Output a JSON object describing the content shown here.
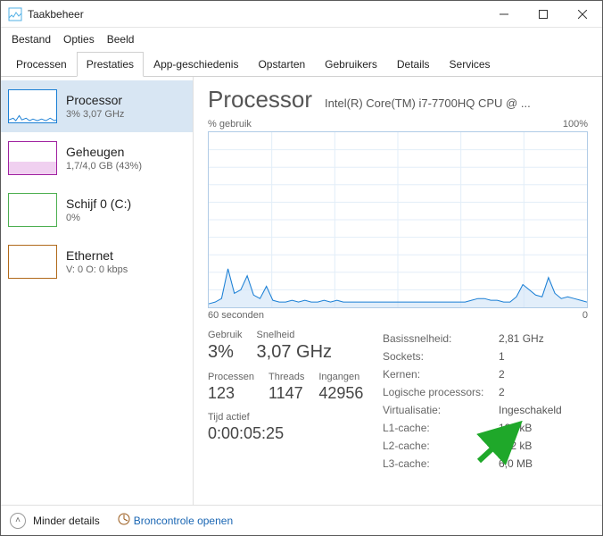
{
  "window": {
    "title": "Taakbeheer"
  },
  "menubar": {
    "items": [
      "Bestand",
      "Opties",
      "Beeld"
    ]
  },
  "tabs": {
    "items": [
      "Processen",
      "Prestaties",
      "App-geschiedenis",
      "Opstarten",
      "Gebruikers",
      "Details",
      "Services"
    ],
    "activeIndex": 1
  },
  "sidebar": {
    "items": [
      {
        "name": "Processor",
        "sub": "3% 3,07 GHz",
        "selected": true
      },
      {
        "name": "Geheugen",
        "sub": "1,7/4,0 GB (43%)"
      },
      {
        "name": "Schijf 0 (C:)",
        "sub": "0%"
      },
      {
        "name": "Ethernet",
        "sub": "V: 0 O: 0 kbps"
      }
    ]
  },
  "header": {
    "title": "Processor",
    "subtitle": "Intel(R) Core(TM) i7-7700HQ CPU @ ..."
  },
  "chart": {
    "topLeft": "% gebruik",
    "topRight": "100%",
    "bottomLeft": "60 seconden",
    "bottomRight": "0"
  },
  "statsLeft": {
    "row1": [
      {
        "label": "Gebruik",
        "value": "3%"
      },
      {
        "label": "Snelheid",
        "value": "3,07 GHz"
      }
    ],
    "row2": [
      {
        "label": "Processen",
        "value": "123"
      },
      {
        "label": "Threads",
        "value": "1147"
      },
      {
        "label": "Ingangen",
        "value": "42956"
      }
    ],
    "uptime": {
      "label": "Tijd actief",
      "value": "0:00:05:25"
    }
  },
  "statsRight": [
    {
      "label": "Basissnelheid:",
      "value": "2,81 GHz"
    },
    {
      "label": "Sockets:",
      "value": "1"
    },
    {
      "label": "Kernen:",
      "value": "2"
    },
    {
      "label": "Logische processors:",
      "value": "2"
    },
    {
      "label": "Virtualisatie:",
      "value": "Ingeschakeld"
    },
    {
      "label": "L1-cache:",
      "value": "128 kB"
    },
    {
      "label": "L2-cache:",
      "value": "512 kB"
    },
    {
      "label": "L3-cache:",
      "value": "6,0 MB"
    }
  ],
  "footer": {
    "less": "Minder details",
    "resmon": "Broncontrole openen"
  },
  "chart_data": {
    "type": "line",
    "title": "% gebruik",
    "xlabel": "60 seconden",
    "ylabel": "% gebruik",
    "ylim": [
      0,
      100
    ],
    "x": [
      0,
      1,
      2,
      3,
      4,
      5,
      6,
      7,
      8,
      9,
      10,
      11,
      12,
      13,
      14,
      15,
      16,
      17,
      18,
      19,
      20,
      21,
      22,
      23,
      24,
      25,
      26,
      27,
      28,
      29,
      30,
      31,
      32,
      33,
      34,
      35,
      36,
      37,
      38,
      39,
      40,
      41,
      42,
      43,
      44,
      45,
      46,
      47,
      48,
      49,
      50,
      51,
      52,
      53,
      54,
      55,
      56,
      57,
      58,
      59
    ],
    "values": [
      2,
      3,
      5,
      22,
      8,
      10,
      18,
      7,
      5,
      12,
      4,
      3,
      3,
      4,
      3,
      4,
      3,
      3,
      4,
      3,
      4,
      3,
      3,
      3,
      3,
      3,
      3,
      3,
      3,
      3,
      3,
      3,
      3,
      3,
      3,
      3,
      3,
      3,
      3,
      3,
      3,
      4,
      5,
      5,
      4,
      4,
      3,
      3,
      6,
      13,
      10,
      7,
      6,
      17,
      8,
      5,
      6,
      5,
      4,
      3
    ]
  }
}
